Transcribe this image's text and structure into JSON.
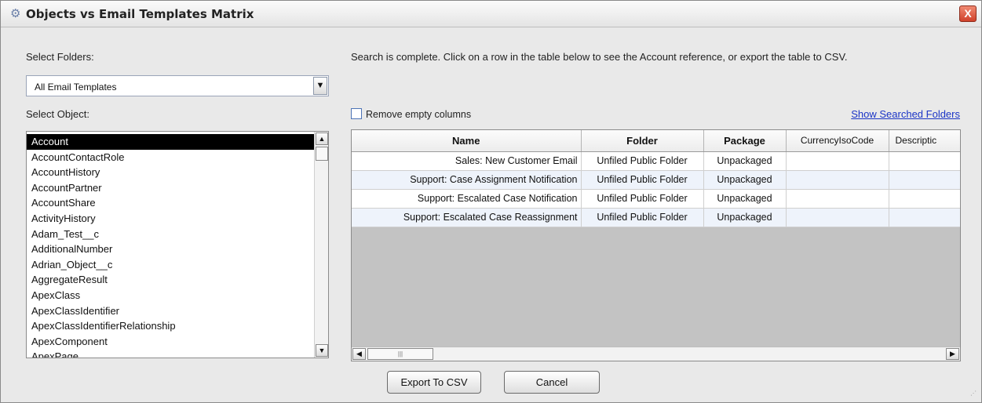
{
  "window": {
    "title": "Objects vs Email Templates Matrix",
    "close_label": "X"
  },
  "left": {
    "folders_label": "Select Folders:",
    "folder_value": "All Email Templates",
    "object_label": "Select Object:",
    "objects": [
      "Account",
      "AccountContactRole",
      "AccountHistory",
      "AccountPartner",
      "AccountShare",
      "ActivityHistory",
      "Adam_Test__c",
      "AdditionalNumber",
      "Adrian_Object__c",
      "AggregateResult",
      "ApexClass",
      "ApexClassIdentifier",
      "ApexClassIdentifierRelationship",
      "ApexComponent",
      "ApexPage"
    ],
    "selected_object": "Account"
  },
  "right": {
    "status": "Search is complete. Click on a row in the table below to see the Account reference, or export the table to CSV.",
    "remove_empty_label": "Remove empty columns",
    "remove_empty_checked": false,
    "show_folders_link": "Show Searched Folders"
  },
  "table": {
    "headers": [
      "Name",
      "Folder",
      "Package",
      "CurrencyIsoCode",
      "Descriptic"
    ],
    "rows": [
      [
        "Sales: New Customer Email",
        "Unfiled Public Folder",
        "Unpackaged",
        "",
        ""
      ],
      [
        "Support: Case Assignment Notification",
        "Unfiled Public Folder",
        "Unpackaged",
        "",
        ""
      ],
      [
        "Support: Escalated Case Notification",
        "Unfiled Public Folder",
        "Unpackaged",
        "",
        ""
      ],
      [
        "Support: Escalated Case Reassignment",
        "Unfiled Public Folder",
        "Unpackaged",
        "",
        ""
      ]
    ]
  },
  "buttons": {
    "export": "Export To CSV",
    "cancel": "Cancel"
  },
  "icons": {
    "title": "gear-icon",
    "close": "close-icon",
    "dropdown": "chevron-down-icon"
  }
}
